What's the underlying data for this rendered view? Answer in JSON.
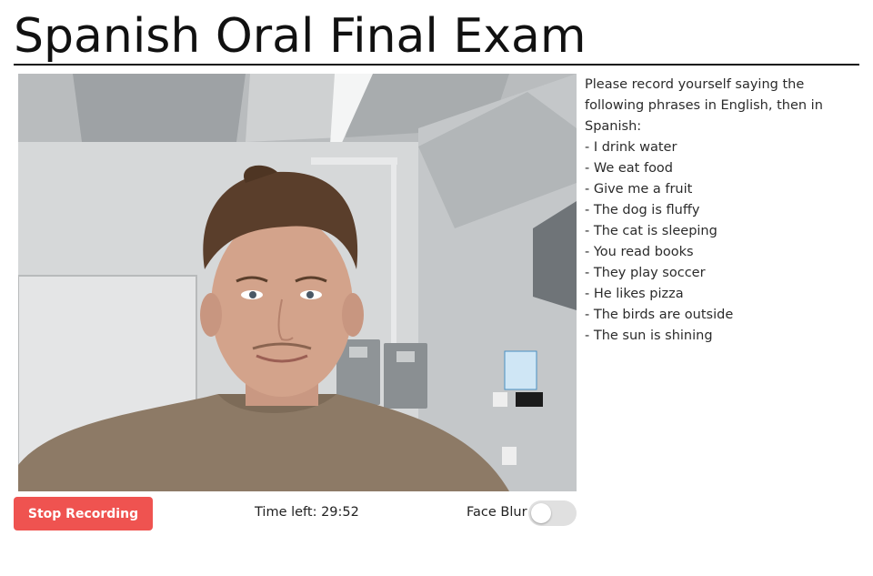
{
  "page": {
    "title": "Spanish Oral Final Exam"
  },
  "instructions": {
    "text": "Please record yourself saying the following phrases in English, then in Spanish:",
    "phrases": [
      "- I drink water",
      "- We eat food",
      "- Give me a fruit",
      "- The dog is fluffy",
      "- The cat is sleeping",
      "- You read books",
      "- They play soccer",
      "- He likes pizza",
      "- The birds are outside",
      "- The sun is shining"
    ]
  },
  "controls": {
    "stop_label": "Stop Recording",
    "timer_text": "Time left: 29:52",
    "face_blur_label": "Face Blur",
    "face_blur_on": false
  },
  "colors": {
    "stop_button": "#ef5350",
    "toggle_track": "#e0e0e0"
  }
}
